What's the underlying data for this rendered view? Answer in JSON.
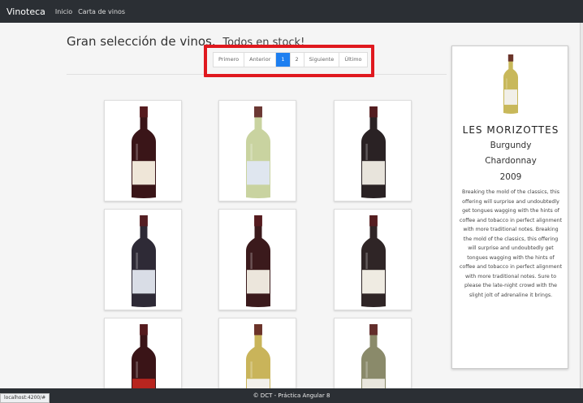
{
  "navbar": {
    "brand": "Vinoteca",
    "links": [
      "Inicio",
      "Carta de vinos"
    ]
  },
  "heading": {
    "title": "Gran selección de vinos.",
    "subtitle": "Todos en stock!"
  },
  "pagination": {
    "buttons": [
      "Primero",
      "Anterior",
      "1",
      "2",
      "Siguiente",
      "Último"
    ],
    "active_index": 2
  },
  "wines": [
    {
      "icon": "red-wine-bottle-icon",
      "bottle_color": "#3a1518",
      "label_color": "#efe6d8"
    },
    {
      "icon": "white-wine-bottle-icon",
      "bottle_color": "#c9d3a0",
      "label_color": "#dfe6ef"
    },
    {
      "icon": "red-wine-bottle-icon",
      "bottle_color": "#2a2224",
      "label_color": "#e8e4dc"
    },
    {
      "icon": "red-wine-bottle-icon",
      "bottle_color": "#2e2a36",
      "label_color": "#d9dde6"
    },
    {
      "icon": "red-wine-bottle-icon",
      "bottle_color": "#3b1a1c",
      "label_color": "#ece6dc"
    },
    {
      "icon": "red-wine-bottle-icon",
      "bottle_color": "#2f2526",
      "label_color": "#efebe2"
    },
    {
      "icon": "red-wine-bottle-icon",
      "bottle_color": "#3a1417",
      "label_color": "#b8251f"
    },
    {
      "icon": "white-wine-bottle-icon",
      "bottle_color": "#c9b45a",
      "label_color": "#f2f0ea"
    },
    {
      "icon": "white-wine-bottle-icon",
      "bottle_color": "#8a8a6a",
      "label_color": "#e9e6dd"
    }
  ],
  "detail": {
    "name": "LES MORIZOTTES",
    "region": "Burgundy",
    "grape": "Chardonnay",
    "year": "2009",
    "description": "Breaking the mold of the classics, this offering will surprise and undoubtedly get tongues wagging with the hints of coffee and tobacco in perfect alignment with more traditional notes. Breaking the mold of the classics, this offering will surprise and undoubtedly get tongues wagging with the hints of coffee and tobacco in perfect alignment with more traditional notes. Sure to please the late-night crowd with the slight jolt of adrenaline it brings.",
    "bottle_color": "#c8b85a",
    "label_color": "#f1efe8"
  },
  "footer": {
    "text": "© DCT - Práctica Angular 8"
  },
  "status_bar": {
    "url": "localhost:4200/#"
  },
  "colors": {
    "accent": "#1e7ff0",
    "highlight": "#e0191f",
    "navbar": "#2b2f34"
  }
}
